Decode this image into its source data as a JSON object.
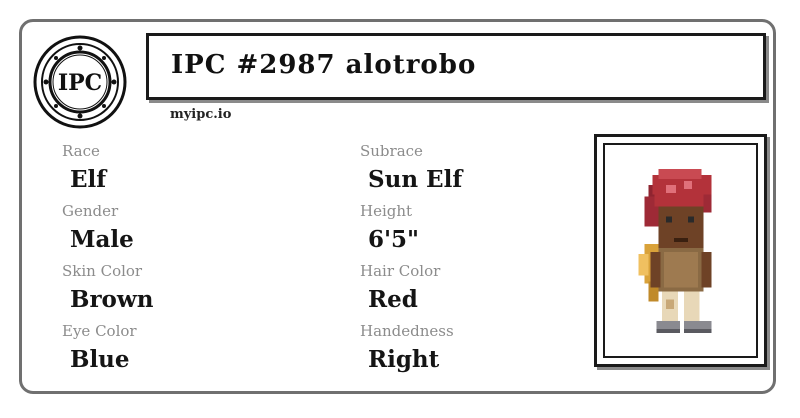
{
  "seal": {
    "text": "IPC"
  },
  "header": {
    "title": "IPC #2987 alotrobo",
    "site": "myipc.io"
  },
  "attributes": {
    "race_label": "Race",
    "race_value": "Elf",
    "subrace_label": "Subrace",
    "subrace_value": "Sun Elf",
    "gender_label": "Gender",
    "gender_value": "Male",
    "height_label": "Height",
    "height_value": "6'5\"",
    "skin_label": "Skin Color",
    "skin_value": "Brown",
    "hair_label": "Hair Color",
    "hair_value": "Red",
    "eye_label": "Eye Color",
    "eye_value": "Blue",
    "hand_label": "Handedness",
    "hand_value": "Right"
  },
  "portrait": {
    "icon": "character-sprite-icon"
  },
  "colors": {
    "border": "#707070",
    "label": "#8c8c8c",
    "hair": "#b3323a",
    "skin": "#7a4a2a"
  }
}
